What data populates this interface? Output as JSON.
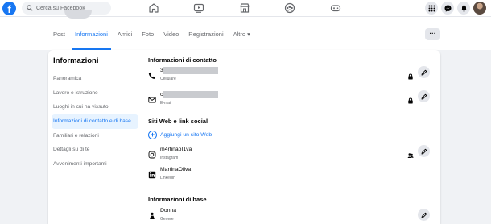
{
  "topbar": {
    "logo_letter": "f",
    "search_placeholder": "Cerca su Facebook",
    "nav_icons": [
      "home-icon",
      "watch-icon",
      "marketplace-icon",
      "groups-icon",
      "gaming-icon"
    ],
    "right_icons": [
      "menu-grid-icon",
      "messenger-icon",
      "notifications-icon",
      "account-avatar"
    ]
  },
  "tabs": [
    {
      "label": "Post"
    },
    {
      "label": "Informazioni"
    },
    {
      "label": "Amici"
    },
    {
      "label": "Foto"
    },
    {
      "label": "Video"
    },
    {
      "label": "Registrazioni"
    },
    {
      "label": "Altro ▾"
    }
  ],
  "more_button": "···",
  "sidebar": {
    "title": "Informazioni",
    "items": [
      {
        "label": "Panoramica"
      },
      {
        "label": "Lavoro e istruzione"
      },
      {
        "label": "Luoghi in cui ha vissuto"
      },
      {
        "label": "Informazioni di contatto e di base"
      },
      {
        "label": "Familiari e relazioni"
      },
      {
        "label": "Dettagli su di te"
      },
      {
        "label": "Avvenimenti importanti"
      }
    ]
  },
  "contact": {
    "title": "Informazioni di contatto",
    "phone": {
      "prefix": "3",
      "sub": "Cellulare"
    },
    "email": {
      "prefix": "c",
      "sub": "E-mail"
    }
  },
  "web": {
    "title": "Siti Web e link social",
    "add_label": "Aggiungi un sito Web",
    "instagram": {
      "value": "m4rtinaoI1va",
      "sub": "Instagram"
    },
    "linkedin": {
      "value": "MartinaOliva",
      "sub": "LinkedIn"
    }
  },
  "basic": {
    "title": "Informazioni di base",
    "gender": {
      "value": "Donna",
      "sub": "Genere"
    }
  },
  "colors": {
    "accent": "#1877f2",
    "bg": "#f0f2f5"
  }
}
